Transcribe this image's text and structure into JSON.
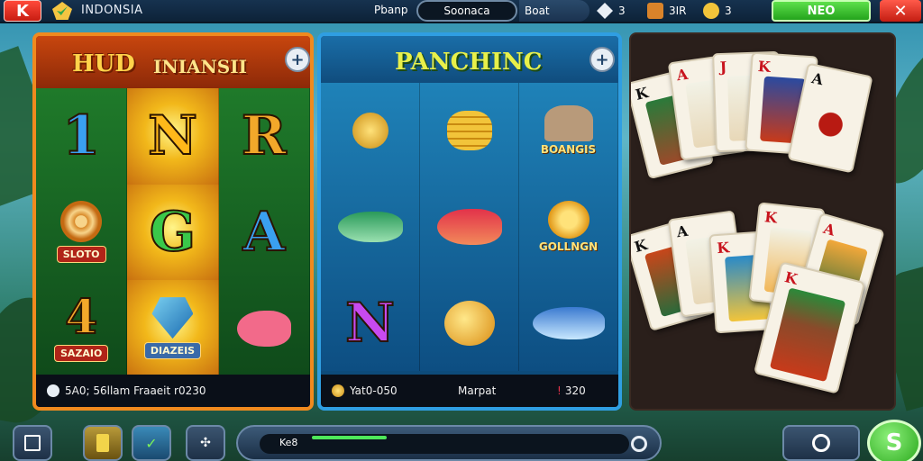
{
  "topbar": {
    "logo": "K",
    "region": "INDONSIA",
    "pill_label": "Pbanp",
    "search_value": "Soonaca",
    "boat_label": "Boat",
    "stat1": "3",
    "stat2": "3IR",
    "stat3": "3",
    "neo_label": "NEO",
    "close_label": "✕"
  },
  "hud_panel": {
    "title": "HUD",
    "subtitle": "INIANSII",
    "add": "+",
    "letters": [
      "1",
      "N",
      "R",
      "G",
      "A",
      "4"
    ],
    "badges": [
      "SLOTO",
      "SAZAIO",
      "DIAZEIS"
    ],
    "footer": "5A0; 56llam Fraaeit r0230"
  },
  "fish_panel": {
    "title": "PANCHINC",
    "add": "+",
    "badges": [
      "BOANGIS",
      "GOLLNGN"
    ],
    "letter": "N",
    "footer_left": "Yat0-050",
    "footer_mid": "Marpat",
    "footer_right": "320"
  },
  "cards_panel": {
    "ranks": [
      "K",
      "A",
      "J",
      "K",
      "A",
      "K",
      "A",
      "K",
      "K",
      "A",
      "K"
    ]
  },
  "bottombar": {
    "progress_label": "Ke8",
    "progress_value": 0.05,
    "play": "S"
  },
  "colors": {
    "accent_orange": "#f08a1e",
    "accent_blue": "#2f9ee2",
    "accent_green": "#4ee85a",
    "danger_red": "#c81d12"
  }
}
